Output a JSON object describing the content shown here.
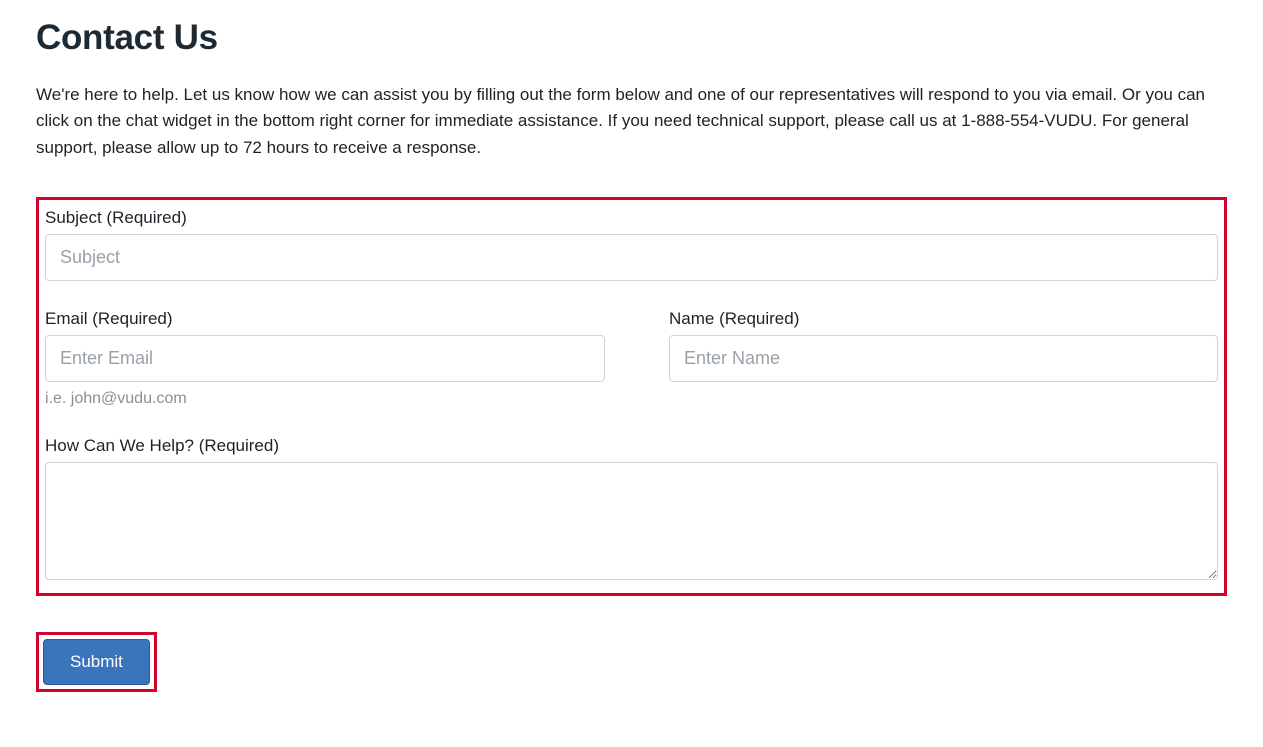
{
  "title": "Contact Us",
  "intro": "We're here to help. Let us know how we can assist you by filling out the form below and one of our representatives will respond to you via email. Or you can click on the chat widget in the bottom right corner for immediate assistance. If you need technical support, please call us at 1-888-554-VUDU. For general support, please allow up to 72 hours to receive a response.",
  "form": {
    "subject": {
      "label": "Subject (Required)",
      "placeholder": "Subject",
      "value": ""
    },
    "email": {
      "label": "Email (Required)",
      "placeholder": "Enter Email",
      "value": "",
      "help": "i.e. john@vudu.com"
    },
    "name": {
      "label": "Name (Required)",
      "placeholder": "Enter Name",
      "value": ""
    },
    "message": {
      "label": "How Can We Help? (Required)",
      "value": ""
    },
    "submit_label": "Submit"
  },
  "colors": {
    "highlight_border": "#d2042d",
    "button_bg": "#3a74bd"
  }
}
